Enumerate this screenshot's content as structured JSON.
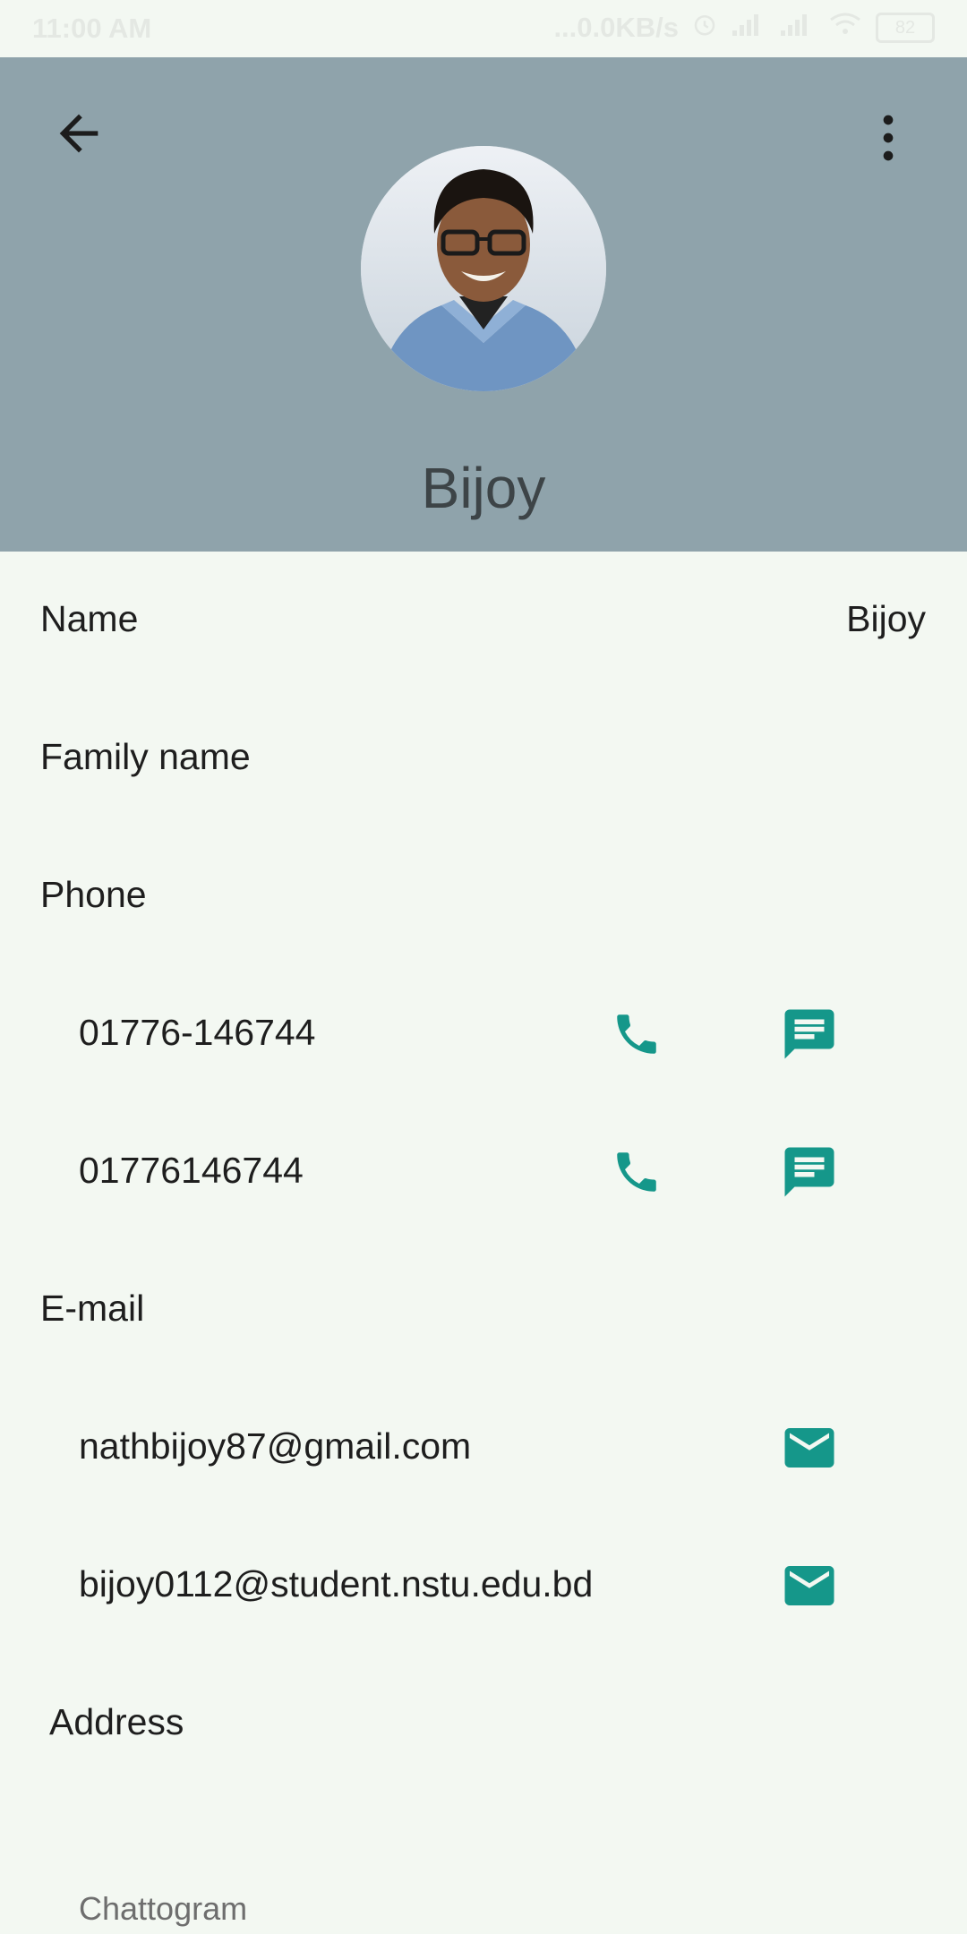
{
  "status_bar": {
    "time": "11:00 AM",
    "network_speed": "...0.0KB/s",
    "battery": "82"
  },
  "header": {
    "title": "Bijoy",
    "back_icon": "arrow-back-icon",
    "menu_icon": "more-vert-icon"
  },
  "fields": {
    "name_label": "Name",
    "name_value": "Bijoy",
    "family_name_label": "Family name",
    "phone_label": "Phone",
    "email_label": "E-mail",
    "address_label": "Address"
  },
  "phones": [
    {
      "number": "01776-146744"
    },
    {
      "number": "01776146744"
    }
  ],
  "emails": [
    {
      "address": "nathbijoy87@gmail.com"
    },
    {
      "address": "bijoy0112@student.nstu.edu.bd"
    }
  ],
  "address": {
    "city": "Chattogram"
  },
  "colors": {
    "header_bg": "#8fa3ab",
    "page_bg": "#f3f8f2",
    "accent": "#15978a"
  }
}
